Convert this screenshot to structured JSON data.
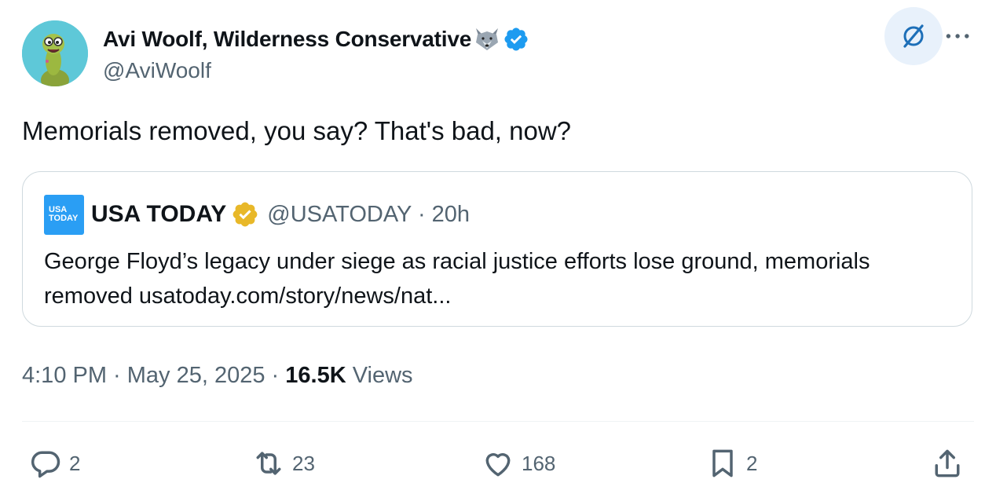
{
  "author": {
    "display_name": "Avi Woolf, Wilderness Conservative",
    "handle": "@AviWoolf",
    "emoji_icon": "wolf-face-icon",
    "verified_color": "#1d9bf0"
  },
  "tweet": {
    "text": "Memorials removed, you say? That's bad, now?"
  },
  "quote": {
    "logo_text_line1": "USA",
    "logo_text_line2": "TODAY",
    "name": "USA TODAY",
    "handle_time": "@USATODAY · 20h",
    "text": "George Floyd’s legacy under siege as racial justice efforts lose ground, memorials removed usatoday.com/story/news/nat..."
  },
  "meta": {
    "time_date": "4:10 PM · May 25, 2025 · ",
    "views_count": "16.5K",
    "views_label": " Views"
  },
  "actions": {
    "replies": "2",
    "reposts": "23",
    "likes": "168",
    "bookmarks": "2"
  },
  "colors": {
    "accent": "#1d9bf0",
    "gold_badge": "#e8b829",
    "muted_text": "#536471"
  }
}
